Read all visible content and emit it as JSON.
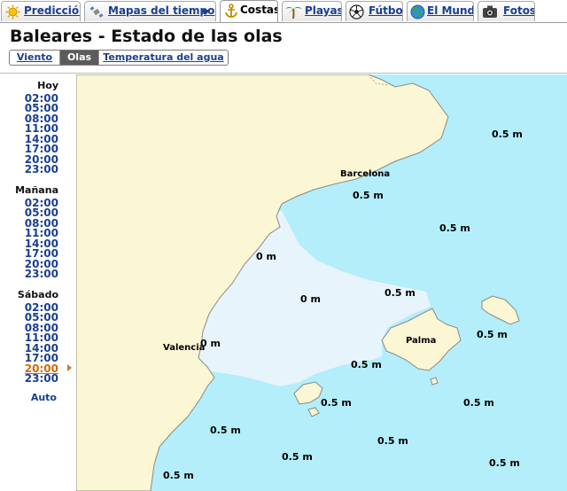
{
  "tabs": [
    {
      "label": "Predicción",
      "icon": "sun-icon"
    },
    {
      "label": "Mapas del tiempo",
      "icon": "satellite-icon"
    },
    {
      "label": "Costas",
      "icon": "anchor-icon"
    },
    {
      "label": "Playas",
      "icon": "palm-tree-icon"
    },
    {
      "label": "Fútbol",
      "icon": "soccer-ball-icon"
    },
    {
      "label": "El Mundo",
      "icon": "globe-icon"
    },
    {
      "label": "Fotos",
      "icon": "camera-icon"
    }
  ],
  "active_tab": "Costas",
  "page_title": "Baleares - Estado de las olas",
  "subtabs": [
    "Viento",
    "Olas",
    "Temperatura del agua"
  ],
  "active_subtab": "Olas",
  "days": [
    {
      "label": "Hoy",
      "times": [
        "02:00",
        "05:00",
        "08:00",
        "11:00",
        "14:00",
        "17:00",
        "20:00",
        "23:00"
      ]
    },
    {
      "label": "Mañana",
      "times": [
        "02:00",
        "05:00",
        "08:00",
        "11:00",
        "14:00",
        "17:00",
        "20:00",
        "23:00"
      ]
    },
    {
      "label": "Sábado",
      "times": [
        "02:00",
        "05:00",
        "08:00",
        "11:00",
        "14:00",
        "17:00",
        "20:00",
        "23:00"
      ]
    }
  ],
  "selected_time": {
    "day": "Sábado",
    "time": "20:00"
  },
  "auto_label": "Auto",
  "map": {
    "cities": [
      "Barcelona",
      "Valencia",
      "Palma"
    ],
    "wave_labels": [
      "0.5 m",
      "0.5 m",
      "0.5 m",
      "0 m",
      "0 m",
      "0.5 m",
      "0.5 m",
      "0 m",
      "0.5 m",
      "0.5 m",
      "0.5 m",
      "0.5 m",
      "0.5 m",
      "0.5 m",
      "0.5 m",
      "0.5 m",
      "0.5 m"
    ]
  },
  "colors": {
    "land": "#fbf6d3",
    "sea": "#b3eefa",
    "calm_sea": "#e7f4fb",
    "link": "#1a3f8f",
    "selected": "#cf6a00"
  }
}
